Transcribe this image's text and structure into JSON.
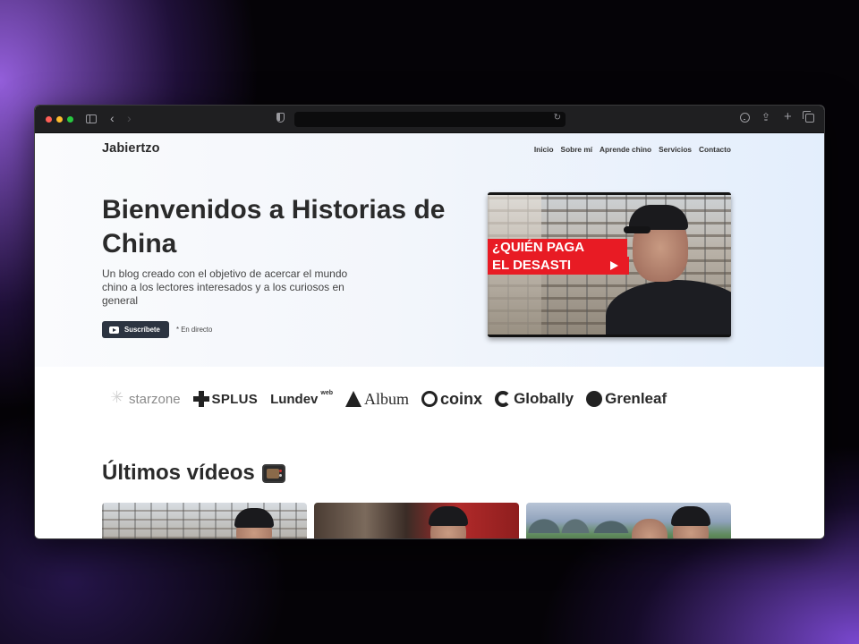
{
  "browser": {
    "address": "",
    "icons": [
      "sidebar-icon",
      "back-icon",
      "forward-icon",
      "shield-icon",
      "reload-icon",
      "download-icon",
      "share-icon",
      "plus-icon",
      "tabs-icon"
    ]
  },
  "site": {
    "brand": "Jabiertzo",
    "nav": [
      {
        "label": "Inicio"
      },
      {
        "label": "Sobre mí"
      },
      {
        "label": "Aprende chino"
      },
      {
        "label": "Servicios"
      },
      {
        "label": "Contacto"
      }
    ]
  },
  "hero": {
    "title": "Bienvenidos a Historias de China",
    "subtitle": "Un blog creado con el objetivo de acercar el mundo chino a los lectores interesados y a los curiosos en general",
    "subscribe_label": "Suscríbete",
    "live_label": "* En directo",
    "video": {
      "banner_line1": "¿QUIÉN PAGA",
      "banner_line2": "EL DESASTI"
    }
  },
  "logos": [
    {
      "name": "starzone",
      "text": "starzone"
    },
    {
      "name": "splus",
      "text": "SPLUS"
    },
    {
      "name": "lundev",
      "text": "Lundev",
      "tag": "web"
    },
    {
      "name": "album",
      "text": "Album"
    },
    {
      "name": "coinx",
      "text": "coinx"
    },
    {
      "name": "globally",
      "text": "Globally"
    },
    {
      "name": "grenleaf",
      "text": "Grenleaf"
    }
  ],
  "latest": {
    "title": "Últimos vídeos",
    "icon": "tv-icon"
  },
  "colors": {
    "accent_red": "#e81b24",
    "button_dark": "#2c3441",
    "hero_gradient_end": "#e3eefc"
  }
}
